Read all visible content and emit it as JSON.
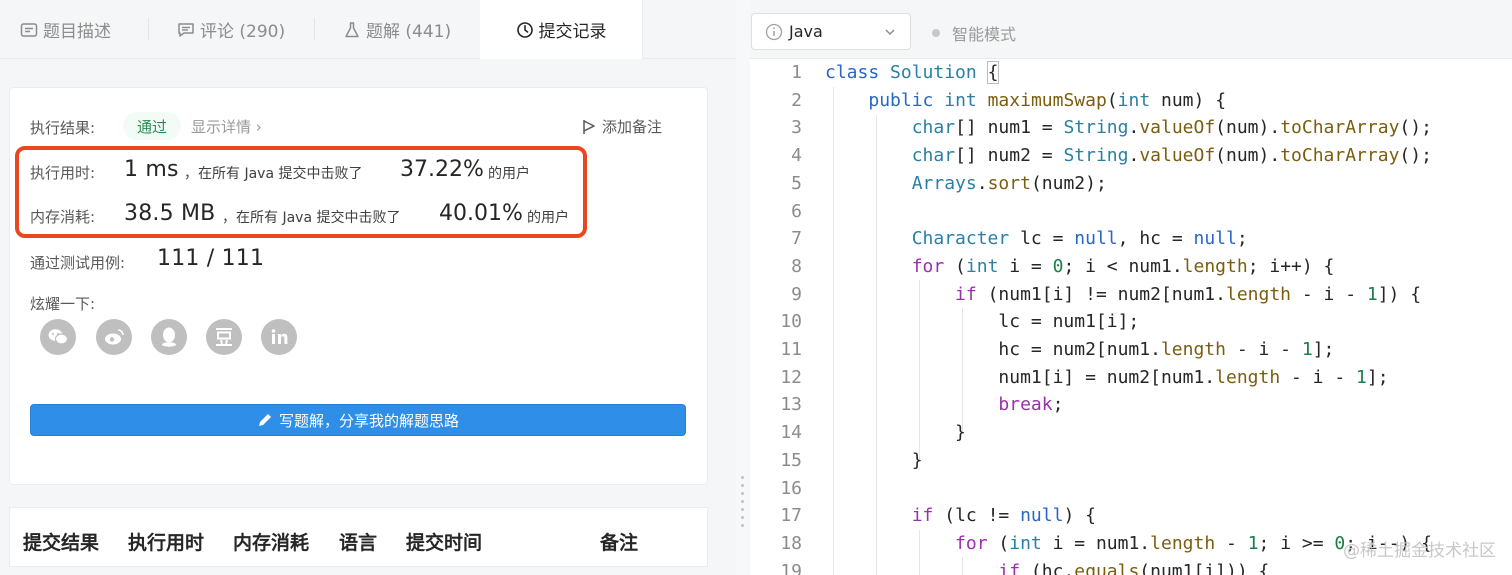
{
  "tabs": [
    {
      "label": "题目描述",
      "icon": "description-icon"
    },
    {
      "label": "评论 (290)",
      "icon": "comment-icon"
    },
    {
      "label": "题解 (441)",
      "icon": "flask-icon"
    },
    {
      "label": "提交记录",
      "icon": "clock-icon",
      "active": true
    }
  ],
  "result": {
    "label": "执行结果:",
    "status": "通过",
    "detail_link": "显示详情 ›",
    "add_note": "添加备注"
  },
  "runtime": {
    "label": "执行用时:",
    "value": "1 ms",
    "middle": "，在所有 Java 提交中击败了",
    "percent": "37.22%",
    "suffix": "的用户"
  },
  "memory": {
    "label": "内存消耗:",
    "value": "38.5 MB",
    "middle": "，在所有 Java 提交中击败了",
    "percent": "40.01%",
    "suffix": "的用户"
  },
  "tests": {
    "label": "通过测试用例:",
    "value": "111 / 111"
  },
  "share": {
    "label": "炫耀一下:",
    "icons": [
      "wechat-icon",
      "weibo-icon",
      "qq-icon",
      "douban-icon",
      "linkedin-icon"
    ]
  },
  "write_button": "写题解，分享我的解题思路",
  "table_headers": [
    "提交结果",
    "执行用时",
    "内存消耗",
    "语言",
    "提交时间",
    "备注"
  ],
  "editor": {
    "language": "Java",
    "smart_mode": "智能模式",
    "line_numbers": [
      "1",
      "2",
      "3",
      "4",
      "5",
      "6",
      "7",
      "8",
      "9",
      "10",
      "11",
      "12",
      "13",
      "14",
      "15",
      "16",
      "17",
      "18",
      "19"
    ]
  },
  "watermark": "@稀土掘金技术社区",
  "colors": {
    "accent_blue": "#2f8fe8",
    "highlight_red": "#e8471f",
    "pass_green": "#2d8a55"
  }
}
